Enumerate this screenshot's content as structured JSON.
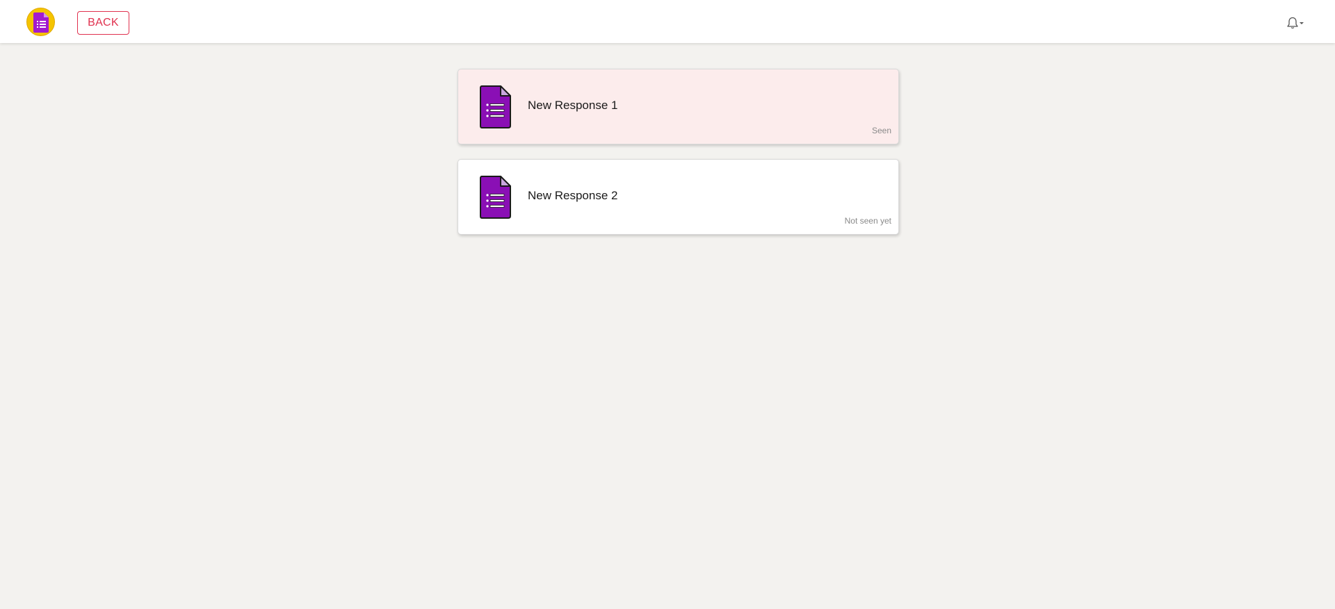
{
  "header": {
    "logo_icon": "forms-logo-icon",
    "back_label": "BACK",
    "notification_icon": "bell-icon",
    "accent_color": "#e0304e",
    "logo_color": "#f5c400"
  },
  "responses": [
    {
      "title": "New Response 1",
      "status": "Seen",
      "icon": "form-document-icon"
    },
    {
      "title": "New Response 2",
      "status": "Not seen yet",
      "icon": "form-document-icon"
    }
  ],
  "colors": {
    "seen_card_bg": "#fcecec",
    "unseen_card_bg": "#ffffff",
    "page_bg": "#f3f2ef",
    "icon_purple": "#8a0fb5"
  }
}
